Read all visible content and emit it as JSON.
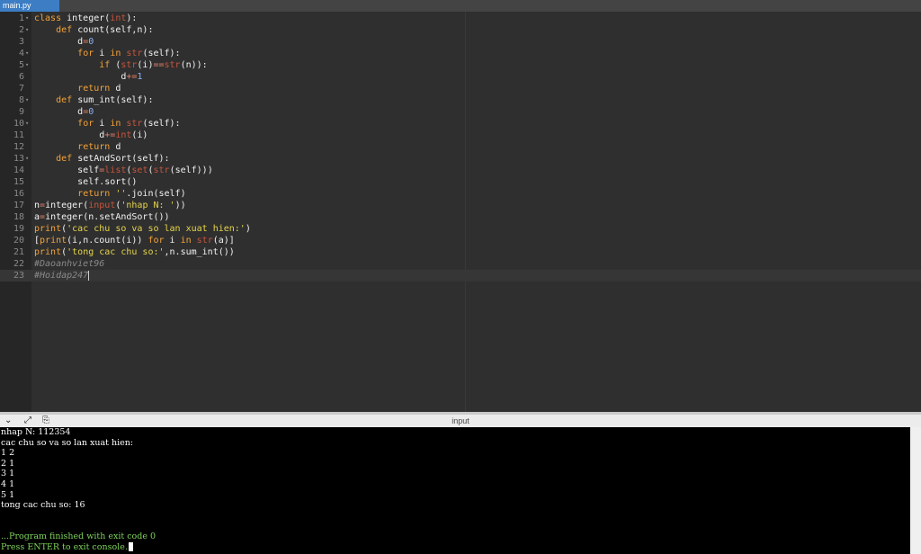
{
  "tab": {
    "label": "main.py"
  },
  "editor": {
    "lines": [
      {
        "n": "1",
        "fold": "▾",
        "t": [
          [
            "kw",
            "class "
          ],
          [
            "",
            "integer("
          ],
          [
            "bi",
            "int"
          ],
          [
            "",
            "):"
          ]
        ]
      },
      {
        "n": "2",
        "fold": "▾",
        "t": [
          [
            "",
            "    "
          ],
          [
            "kw",
            "def "
          ],
          [
            "",
            "count(self,n):"
          ]
        ]
      },
      {
        "n": "3",
        "fold": "",
        "t": [
          [
            "",
            "        d"
          ],
          [
            "op",
            "="
          ],
          [
            "num",
            "0"
          ]
        ]
      },
      {
        "n": "4",
        "fold": "▾",
        "t": [
          [
            "",
            "        "
          ],
          [
            "kw",
            "for "
          ],
          [
            "",
            "i "
          ],
          [
            "kw",
            "in "
          ],
          [
            "bi",
            "str"
          ],
          [
            "",
            "(self):"
          ]
        ]
      },
      {
        "n": "5",
        "fold": "▾",
        "t": [
          [
            "",
            "            "
          ],
          [
            "kw",
            "if "
          ],
          [
            "",
            "("
          ],
          [
            "bi",
            "str"
          ],
          [
            "",
            "(i)"
          ],
          [
            "op",
            "=="
          ],
          [
            "bi",
            "str"
          ],
          [
            "",
            "(n)):"
          ]
        ]
      },
      {
        "n": "6",
        "fold": "",
        "t": [
          [
            "",
            "                d"
          ],
          [
            "op",
            "+="
          ],
          [
            "num",
            "1"
          ]
        ]
      },
      {
        "n": "7",
        "fold": "",
        "t": [
          [
            "",
            "        "
          ],
          [
            "kw",
            "return "
          ],
          [
            "",
            "d"
          ]
        ]
      },
      {
        "n": "8",
        "fold": "▾",
        "t": [
          [
            "",
            "    "
          ],
          [
            "kw",
            "def "
          ],
          [
            "",
            "sum_int(self):"
          ]
        ]
      },
      {
        "n": "9",
        "fold": "",
        "t": [
          [
            "",
            "        d"
          ],
          [
            "op",
            "="
          ],
          [
            "num",
            "0"
          ]
        ]
      },
      {
        "n": "10",
        "fold": "▾",
        "t": [
          [
            "",
            "        "
          ],
          [
            "kw",
            "for "
          ],
          [
            "",
            "i "
          ],
          [
            "kw",
            "in "
          ],
          [
            "bi",
            "str"
          ],
          [
            "",
            "(self):"
          ]
        ]
      },
      {
        "n": "11",
        "fold": "",
        "t": [
          [
            "",
            "            d"
          ],
          [
            "op",
            "+="
          ],
          [
            "bi",
            "int"
          ],
          [
            "",
            "(i)"
          ]
        ]
      },
      {
        "n": "12",
        "fold": "",
        "t": [
          [
            "",
            "        "
          ],
          [
            "kw",
            "return "
          ],
          [
            "",
            "d"
          ]
        ]
      },
      {
        "n": "13",
        "fold": "▾",
        "t": [
          [
            "",
            "    "
          ],
          [
            "kw",
            "def "
          ],
          [
            "",
            "setAndSort(self):"
          ]
        ]
      },
      {
        "n": "14",
        "fold": "",
        "t": [
          [
            "",
            "        self"
          ],
          [
            "op",
            "="
          ],
          [
            "bi",
            "list"
          ],
          [
            "",
            "("
          ],
          [
            "bi",
            "set"
          ],
          [
            "",
            "("
          ],
          [
            "bi",
            "str"
          ],
          [
            "",
            "(self)))"
          ]
        ]
      },
      {
        "n": "15",
        "fold": "",
        "t": [
          [
            "",
            "        self.sort()"
          ]
        ]
      },
      {
        "n": "16",
        "fold": "",
        "t": [
          [
            "",
            "        "
          ],
          [
            "kw",
            "return "
          ],
          [
            "str",
            "''"
          ],
          [
            "",
            ".join(self)"
          ]
        ]
      },
      {
        "n": "17",
        "fold": "",
        "t": [
          [
            "",
            "n"
          ],
          [
            "op",
            "="
          ],
          [
            "",
            "integer("
          ],
          [
            "bi",
            "input"
          ],
          [
            "",
            "("
          ],
          [
            "str",
            "'nhap N: '"
          ],
          [
            "",
            "))"
          ]
        ]
      },
      {
        "n": "18",
        "fold": "",
        "t": [
          [
            "",
            "a"
          ],
          [
            "op",
            "="
          ],
          [
            "",
            "integer(n.setAndSort())"
          ]
        ]
      },
      {
        "n": "19",
        "fold": "",
        "t": [
          [
            "kw",
            "print"
          ],
          [
            "",
            "("
          ],
          [
            "str",
            "'cac chu so va so lan xuat hien:'"
          ],
          [
            "",
            ")"
          ]
        ]
      },
      {
        "n": "20",
        "fold": "",
        "t": [
          [
            "",
            "["
          ],
          [
            "kw",
            "print"
          ],
          [
            "",
            "(i,n.count(i)) "
          ],
          [
            "kw",
            "for "
          ],
          [
            "",
            "i "
          ],
          [
            "kw",
            "in "
          ],
          [
            "bi",
            "str"
          ],
          [
            "",
            "(a)]"
          ]
        ]
      },
      {
        "n": "21",
        "fold": "",
        "t": [
          [
            "kw",
            "print"
          ],
          [
            "",
            "("
          ],
          [
            "str",
            "'tong cac chu so:'"
          ],
          [
            "",
            ",n.sum_int())"
          ]
        ]
      },
      {
        "n": "22",
        "fold": "",
        "t": [
          [
            "cm",
            "#Daoanhviet96"
          ]
        ]
      },
      {
        "n": "23",
        "fold": "",
        "t": [
          [
            "cm",
            "#Hoidap247"
          ]
        ]
      }
    ],
    "active_line": 23
  },
  "io": {
    "title": "input",
    "buttons": [
      {
        "name": "collapse-console-icon",
        "glyph": "⌄"
      },
      {
        "name": "maximize-console-icon",
        "glyph": "⤢"
      },
      {
        "name": "copy-output-icon",
        "glyph": "⎘"
      }
    ]
  },
  "console": {
    "lines": [
      {
        "text": "nhap N: 112354",
        "color": "white"
      },
      {
        "text": "cac chu so va so lan xuat hien:",
        "color": "white"
      },
      {
        "text": "1 2",
        "color": "white"
      },
      {
        "text": "2 1",
        "color": "white"
      },
      {
        "text": "3 1",
        "color": "white"
      },
      {
        "text": "4 1",
        "color": "white"
      },
      {
        "text": "5 1",
        "color": "white"
      },
      {
        "text": "tong cac chu so: 16",
        "color": "white"
      },
      {
        "text": "",
        "color": "white"
      },
      {
        "text": "",
        "color": "white"
      },
      {
        "text": "...Program finished with exit code 0",
        "color": "green"
      },
      {
        "text": "Press ENTER to exit console.",
        "color": "green",
        "cursor": true
      }
    ]
  }
}
